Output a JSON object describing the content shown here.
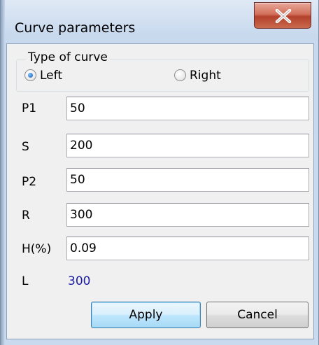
{
  "window": {
    "title": "Curve parameters"
  },
  "group": {
    "label": "Type of curve",
    "options": [
      {
        "label": "Left",
        "selected": true
      },
      {
        "label": "Right",
        "selected": false
      }
    ]
  },
  "fields": [
    {
      "label": "P1",
      "value": "50"
    },
    {
      "label": "S",
      "value": "200"
    },
    {
      "label": "P2",
      "value": "50"
    },
    {
      "label": "R",
      "value": "300"
    },
    {
      "label": "H(%)",
      "value": "0.09"
    }
  ],
  "result": {
    "label": "L",
    "value": "300"
  },
  "buttons": {
    "apply": "Apply",
    "cancel": "Cancel"
  },
  "colors": {
    "result_value": "#1d1da3",
    "close_button": "#c0503a",
    "frame": "#c8d9ee"
  }
}
